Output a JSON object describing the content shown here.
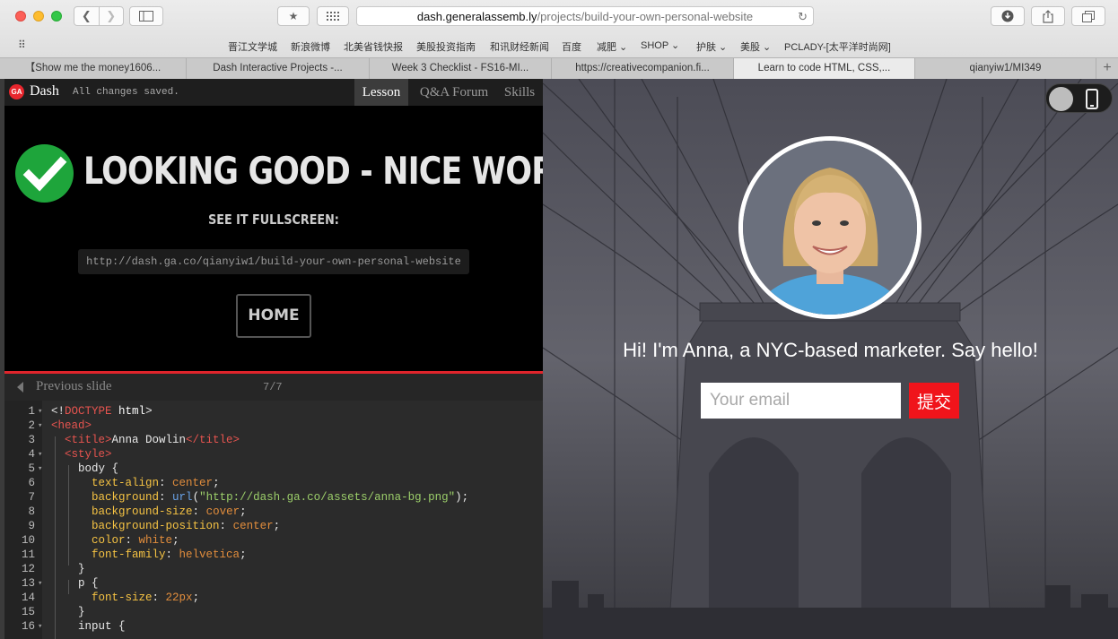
{
  "browser": {
    "url_host": "dash.generalassemb.ly",
    "url_path": "/projects/build-your-own-personal-website",
    "bookmarks": [
      "晋江文学城",
      "新浪微博",
      "北美省钱快报",
      "美股投资指南",
      "和讯财经新闻",
      "百度",
      "减肥 ⌄",
      "SHOP ⌄",
      "护肤 ⌄",
      "美股 ⌄",
      "PCLADY-[太平洋时尚网]"
    ],
    "tabs": [
      "【Show me the money1606...",
      "Dash Interactive Projects -...",
      "Week 3 Checklist - FS16-MI...",
      "https://creativecompanion.fi...",
      "Learn to code HTML, CSS,...",
      "qianyiw1/MI349"
    ],
    "active_tab_index": 4
  },
  "dash": {
    "logo": "GA",
    "title": "Dash",
    "status": "All changes saved.",
    "tabs": [
      "Lesson",
      "Q&A Forum",
      "Skills"
    ],
    "headline": "LOOKING GOOD - NICE WORK!",
    "fullscreen_label": "SEE IT FULLSCREEN:",
    "fullscreen_url": "http://dash.ga.co/qianyiw1/build-your-own-personal-website",
    "home_label": "HOME",
    "prev_label": "Previous slide",
    "slide_counter": "7/7"
  },
  "code_lines": [
    {
      "n": "1",
      "fold": "▾",
      "html": "<span class=\"c-punc\">&lt;!</span><span class=\"c-tag\">DOCTYPE</span> <span class=\"c-kw\">html</span><span class=\"c-punc\">&gt;</span>"
    },
    {
      "n": "2",
      "fold": "▾",
      "html": "<span class=\"c-tag\">&lt;head&gt;</span>"
    },
    {
      "n": "3",
      "fold": "",
      "html": "  <span class=\"c-tag\">&lt;title&gt;</span>Anna Dowlin<span class=\"c-tag\">&lt;/title&gt;</span>"
    },
    {
      "n": "4",
      "fold": "▾",
      "html": "  <span class=\"c-tag\">&lt;style&gt;</span>"
    },
    {
      "n": "5",
      "fold": "▾",
      "html": "    body {"
    },
    {
      "n": "6",
      "fold": "",
      "html": "      <span class=\"c-prop\">text-align</span>: <span class=\"c-val\">center</span>;"
    },
    {
      "n": "7",
      "fold": "",
      "html": "      <span class=\"c-prop\">background</span>: <span class=\"c-fn\">url</span>(<span class=\"c-str\">\"http://dash.ga.co/assets/anna-bg.png\"</span>);"
    },
    {
      "n": "8",
      "fold": "",
      "html": "      <span class=\"c-prop\">background-size</span>: <span class=\"c-val\">cover</span>;"
    },
    {
      "n": "9",
      "fold": "",
      "html": "      <span class=\"c-prop\">background-position</span>: <span class=\"c-val\">center</span>;"
    },
    {
      "n": "10",
      "fold": "",
      "html": "      <span class=\"c-prop\">color</span>: <span class=\"c-val\">white</span>;"
    },
    {
      "n": "11",
      "fold": "",
      "html": "      <span class=\"c-prop\">font-family</span>: <span class=\"c-val\">helvetica</span>;"
    },
    {
      "n": "12",
      "fold": "",
      "html": "    }"
    },
    {
      "n": "13",
      "fold": "▾",
      "html": "    p {"
    },
    {
      "n": "14",
      "fold": "",
      "html": "      <span class=\"c-prop\">font-size</span>: <span class=\"c-val\">22px</span>;"
    },
    {
      "n": "15",
      "fold": "",
      "html": "    }"
    },
    {
      "n": "16",
      "fold": "▾",
      "html": "    input {"
    }
  ],
  "preview": {
    "intro": "Hi! I'm Anna, a NYC-based marketer. Say hello!",
    "email_placeholder": "Your email",
    "submit_label": "提交"
  },
  "colors": {
    "ga_red": "#e8262d",
    "check_green": "#1ea53b",
    "submit_red": "#f0141b"
  }
}
